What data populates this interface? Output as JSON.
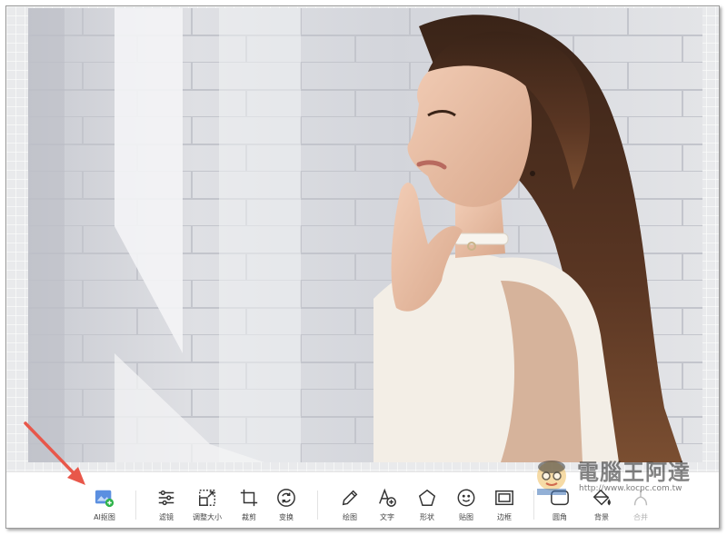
{
  "toolbar": {
    "items": [
      {
        "label": "AI抠图",
        "icon": "ai-cutout-icon"
      },
      {
        "label": "滤镜",
        "icon": "sliders-icon"
      },
      {
        "label": "调整大小",
        "icon": "resize-icon"
      },
      {
        "label": "裁剪",
        "icon": "crop-icon"
      },
      {
        "label": "变换",
        "icon": "rotate-icon"
      },
      {
        "label": "绘图",
        "icon": "pencil-icon"
      },
      {
        "label": "文字",
        "icon": "text-add-icon"
      },
      {
        "label": "形状",
        "icon": "pentagon-icon"
      },
      {
        "label": "贴图",
        "icon": "emoji-icon"
      },
      {
        "label": "边框",
        "icon": "border-frame-icon"
      },
      {
        "label": "圆角",
        "icon": "rounded-corner-icon"
      },
      {
        "label": "背景",
        "icon": "paint-bucket-icon"
      },
      {
        "label": "合并",
        "icon": "merge-icon",
        "disabled": true
      }
    ]
  },
  "watermark": {
    "title": "電腦王阿達",
    "url": "http://www.kocpc.com.tw"
  },
  "colors": {
    "accent": "#1a73e8",
    "arrow": "#e8574a",
    "ai_icon_bg": "#5b8fe0",
    "ai_badge": "#2fb34a"
  }
}
